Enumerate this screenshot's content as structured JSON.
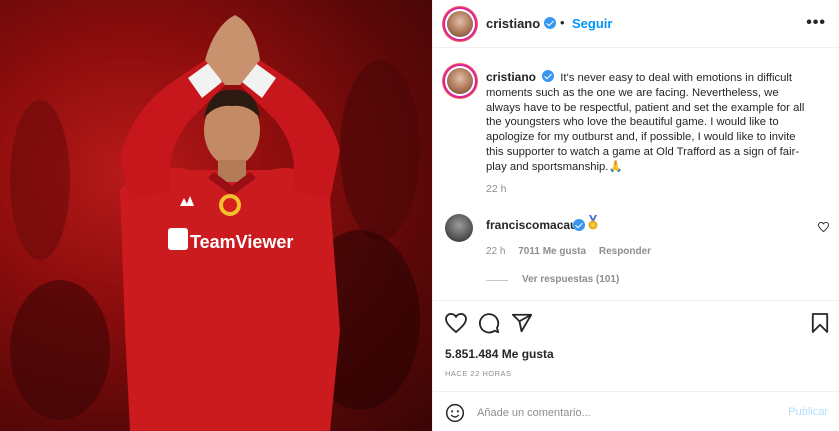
{
  "post": {
    "username": "cristiano",
    "separator": "•",
    "follow_label": "Seguir",
    "more_label": "•••",
    "caption_username": "cristiano",
    "caption_text": "It's never easy to deal with emotions in difficult moments such as the one we are facing. Nevertheless, we always have to be respectful, patient and set the example for all the youngsters who love the beautiful game. I would like to apologize for my outburst and, if possible, I would like to invite this supporter to watch a game at Old Trafford as a sign of fair-play and sportsmanship.🙏",
    "caption_time": "22 h"
  },
  "comment": {
    "username": "franciscomacau",
    "time": "22 h",
    "likes": "7011 Me gusta",
    "reply_label": "Responder",
    "view_replies": "Ver respuestas (101)"
  },
  "actions": {
    "like_icon": "heart-icon",
    "comment_icon": "comment-icon",
    "share_icon": "share-icon",
    "save_icon": "bookmark-icon"
  },
  "stats": {
    "likes": "5.851.484 Me gusta",
    "posted_ago": "HACE 22 HORAS"
  },
  "composer": {
    "placeholder": "Añade un comentario...",
    "post_label": "Publicar"
  },
  "colors": {
    "accent": "#0095f6",
    "verified": "#3897f0",
    "muted": "#8e8e8e",
    "jersey_red": "#c8161d"
  }
}
